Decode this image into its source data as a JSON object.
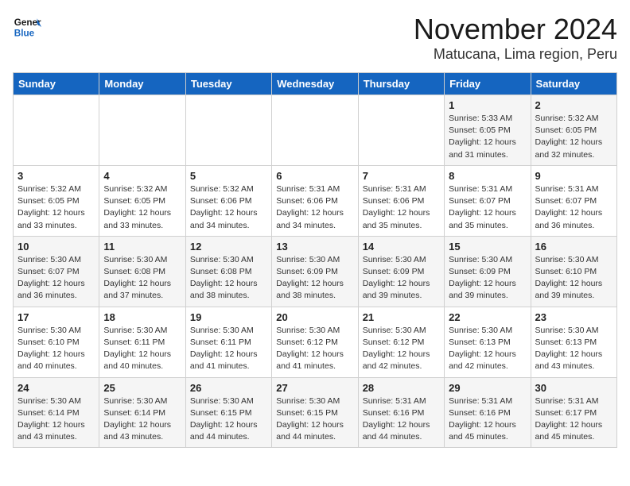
{
  "header": {
    "logo_line1": "General",
    "logo_line2": "Blue",
    "month": "November 2024",
    "location": "Matucana, Lima region, Peru"
  },
  "weekdays": [
    "Sunday",
    "Monday",
    "Tuesday",
    "Wednesday",
    "Thursday",
    "Friday",
    "Saturday"
  ],
  "weeks": [
    [
      {
        "day": "",
        "detail": ""
      },
      {
        "day": "",
        "detail": ""
      },
      {
        "day": "",
        "detail": ""
      },
      {
        "day": "",
        "detail": ""
      },
      {
        "day": "",
        "detail": ""
      },
      {
        "day": "1",
        "detail": "Sunrise: 5:33 AM\nSunset: 6:05 PM\nDaylight: 12 hours and 31 minutes."
      },
      {
        "day": "2",
        "detail": "Sunrise: 5:32 AM\nSunset: 6:05 PM\nDaylight: 12 hours and 32 minutes."
      }
    ],
    [
      {
        "day": "3",
        "detail": "Sunrise: 5:32 AM\nSunset: 6:05 PM\nDaylight: 12 hours and 33 minutes."
      },
      {
        "day": "4",
        "detail": "Sunrise: 5:32 AM\nSunset: 6:05 PM\nDaylight: 12 hours and 33 minutes."
      },
      {
        "day": "5",
        "detail": "Sunrise: 5:32 AM\nSunset: 6:06 PM\nDaylight: 12 hours and 34 minutes."
      },
      {
        "day": "6",
        "detail": "Sunrise: 5:31 AM\nSunset: 6:06 PM\nDaylight: 12 hours and 34 minutes."
      },
      {
        "day": "7",
        "detail": "Sunrise: 5:31 AM\nSunset: 6:06 PM\nDaylight: 12 hours and 35 minutes."
      },
      {
        "day": "8",
        "detail": "Sunrise: 5:31 AM\nSunset: 6:07 PM\nDaylight: 12 hours and 35 minutes."
      },
      {
        "day": "9",
        "detail": "Sunrise: 5:31 AM\nSunset: 6:07 PM\nDaylight: 12 hours and 36 minutes."
      }
    ],
    [
      {
        "day": "10",
        "detail": "Sunrise: 5:30 AM\nSunset: 6:07 PM\nDaylight: 12 hours and 36 minutes."
      },
      {
        "day": "11",
        "detail": "Sunrise: 5:30 AM\nSunset: 6:08 PM\nDaylight: 12 hours and 37 minutes."
      },
      {
        "day": "12",
        "detail": "Sunrise: 5:30 AM\nSunset: 6:08 PM\nDaylight: 12 hours and 38 minutes."
      },
      {
        "day": "13",
        "detail": "Sunrise: 5:30 AM\nSunset: 6:09 PM\nDaylight: 12 hours and 38 minutes."
      },
      {
        "day": "14",
        "detail": "Sunrise: 5:30 AM\nSunset: 6:09 PM\nDaylight: 12 hours and 39 minutes."
      },
      {
        "day": "15",
        "detail": "Sunrise: 5:30 AM\nSunset: 6:09 PM\nDaylight: 12 hours and 39 minutes."
      },
      {
        "day": "16",
        "detail": "Sunrise: 5:30 AM\nSunset: 6:10 PM\nDaylight: 12 hours and 39 minutes."
      }
    ],
    [
      {
        "day": "17",
        "detail": "Sunrise: 5:30 AM\nSunset: 6:10 PM\nDaylight: 12 hours and 40 minutes."
      },
      {
        "day": "18",
        "detail": "Sunrise: 5:30 AM\nSunset: 6:11 PM\nDaylight: 12 hours and 40 minutes."
      },
      {
        "day": "19",
        "detail": "Sunrise: 5:30 AM\nSunset: 6:11 PM\nDaylight: 12 hours and 41 minutes."
      },
      {
        "day": "20",
        "detail": "Sunrise: 5:30 AM\nSunset: 6:12 PM\nDaylight: 12 hours and 41 minutes."
      },
      {
        "day": "21",
        "detail": "Sunrise: 5:30 AM\nSunset: 6:12 PM\nDaylight: 12 hours and 42 minutes."
      },
      {
        "day": "22",
        "detail": "Sunrise: 5:30 AM\nSunset: 6:13 PM\nDaylight: 12 hours and 42 minutes."
      },
      {
        "day": "23",
        "detail": "Sunrise: 5:30 AM\nSunset: 6:13 PM\nDaylight: 12 hours and 43 minutes."
      }
    ],
    [
      {
        "day": "24",
        "detail": "Sunrise: 5:30 AM\nSunset: 6:14 PM\nDaylight: 12 hours and 43 minutes."
      },
      {
        "day": "25",
        "detail": "Sunrise: 5:30 AM\nSunset: 6:14 PM\nDaylight: 12 hours and 43 minutes."
      },
      {
        "day": "26",
        "detail": "Sunrise: 5:30 AM\nSunset: 6:15 PM\nDaylight: 12 hours and 44 minutes."
      },
      {
        "day": "27",
        "detail": "Sunrise: 5:30 AM\nSunset: 6:15 PM\nDaylight: 12 hours and 44 minutes."
      },
      {
        "day": "28",
        "detail": "Sunrise: 5:31 AM\nSunset: 6:16 PM\nDaylight: 12 hours and 44 minutes."
      },
      {
        "day": "29",
        "detail": "Sunrise: 5:31 AM\nSunset: 6:16 PM\nDaylight: 12 hours and 45 minutes."
      },
      {
        "day": "30",
        "detail": "Sunrise: 5:31 AM\nSunset: 6:17 PM\nDaylight: 12 hours and 45 minutes."
      }
    ]
  ]
}
